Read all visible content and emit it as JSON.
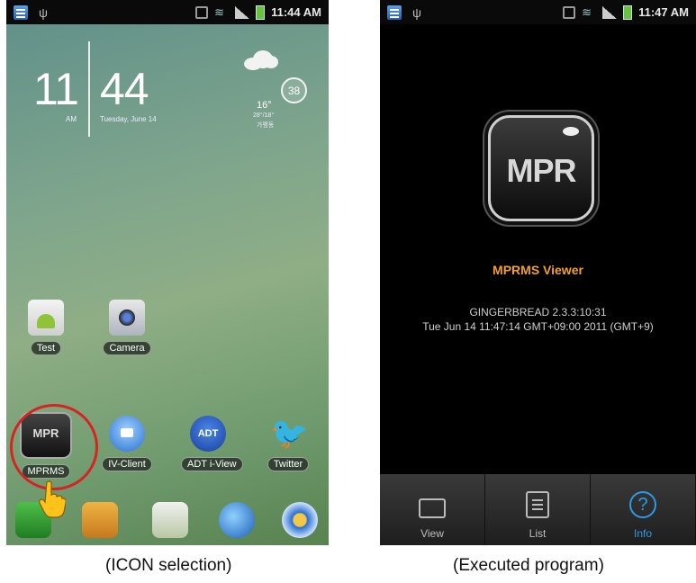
{
  "left_screen": {
    "status": {
      "time": "11:44 AM"
    },
    "clock": {
      "hour": "11",
      "minute": "44",
      "ampm": "AM",
      "date": "Tuesday, June 14"
    },
    "weather": {
      "temp": "16°",
      "range": "28°/18°",
      "location": "가평동"
    },
    "badge": "38",
    "apps_row1": [
      {
        "label": "Test"
      },
      {
        "label": "Camera"
      }
    ],
    "apps_row2": [
      {
        "label": "MPRMS",
        "icon_text": "MPR"
      },
      {
        "label": "IV-Client"
      },
      {
        "label": "ADT i-View",
        "icon_text": "ADT"
      },
      {
        "label": "Twitter"
      }
    ],
    "dock_icons": [
      "phone-icon",
      "folder-icon",
      "market-icon",
      "browser-icon",
      "settings-icon"
    ],
    "highlight_color": "#d42424"
  },
  "right_screen": {
    "status": {
      "time": "11:47 AM"
    },
    "logo_text": "MPR",
    "title": "MPRMS Viewer",
    "version": "GINGERBREAD 2.3.3:10:31",
    "datetime": "Tue Jun 14 11:47:14 GMT+09:00 2011 (GMT+9)",
    "tabs": [
      {
        "label": "View",
        "icon": "tv-icon"
      },
      {
        "label": "List",
        "icon": "list-icon"
      },
      {
        "label": "Info",
        "icon": "info-icon",
        "active": true
      }
    ],
    "title_color": "#f4a126",
    "active_tab_color": "#2b9be6"
  },
  "captions": {
    "left": "(ICON selection)",
    "right": "(Executed program)"
  }
}
